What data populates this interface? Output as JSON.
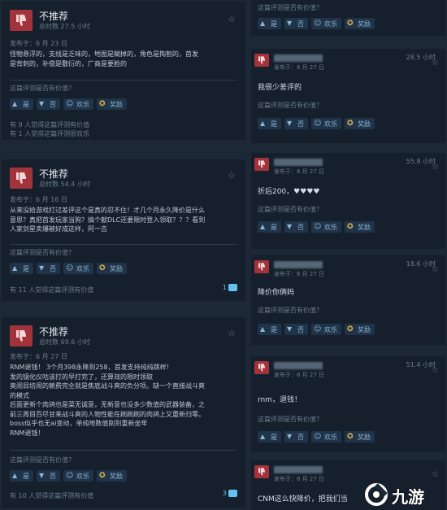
{
  "common": {
    "helpful_question": "这篇评测是否有价值？",
    "yes": "是",
    "no": "否",
    "funny": "欢乐",
    "award": "奖励",
    "verdict": "不推荐"
  },
  "reviews": [
    {
      "hours": "总时数 27.5 小时",
      "date": "发布于：6 月 23 日",
      "lines": [
        "怪物悬浮的，支线是乏味的，地图是糊掉的，角色是掏割的，首发",
        "是背刺的，补偿是敷衍的，厂商是要脸的"
      ],
      "stats": [
        "有 9 人觉得这篇评测有价值",
        "有 1 人觉得这篇评测很欢乐"
      ],
      "comments": ""
    },
    {
      "hours": "总时数 54.4 小时",
      "date": "发布于：6 月 16 日",
      "lines": [
        "从来没给游戏打过差评这个是真的忍不住！才几个月永久降价是什么",
        "意思？真把首发玩家当狗？搞个献DLC还要限时登入领取？？？看到",
        "人家剑星卖爆被好成这样，阿一古"
      ],
      "stats": [
        "有 11 人觉得这篇评测有价值"
      ],
      "comments": "1"
    },
    {
      "hours": "总时数 69.6 小时",
      "date": "发布于：6 月 27 日",
      "lines": [
        "RNM退钱！ 3个月398永降到258，首发支持纯纯跳样！",
        "发的镜化仪咕该打的早打完了，还算效的限时领取",
        "奥闹目坊闹的赖费完全就是焦底战斗爽的负分项。缺一个直接战斗爽",
        "的模式",
        "后面更新个肉鸽也是菜无诚意，无新意也没多少数值的武器装备，之",
        "前三周目百尽甘来战斗爽的人物性能在刷刷刷的肉鸽上又重新归零。",
        "boss似乎也无ai变动，单纯地数值削到重新坐牢",
        "RNM退钱！"
      ],
      "stats": [
        "有 10 人觉得这篇评测有价值"
      ],
      "comments": "3"
    }
  ],
  "comments_column": [
    {
      "hours": "",
      "date": "",
      "text": ""
    },
    {
      "hours": "28.5 小时",
      "date": "发布于：6 月 27 日",
      "text": "我很少差评的"
    },
    {
      "hours": "55.8 小时",
      "date": "发布于：6 月 27 日",
      "text": "折后200，♥♥♥♥"
    },
    {
      "hours": "18.6 小时",
      "date": "发布于：6 月 27 日",
      "text": "降价你俩妈"
    },
    {
      "hours": "51.4 小时",
      "date": "发布于：6 月 27 日",
      "text": "rnm，退钱！"
    },
    {
      "hours": "",
      "date": "发布于：6 月 27 日",
      "text": "CNM这么快降价，把我们当"
    }
  ],
  "watermark": "九游"
}
